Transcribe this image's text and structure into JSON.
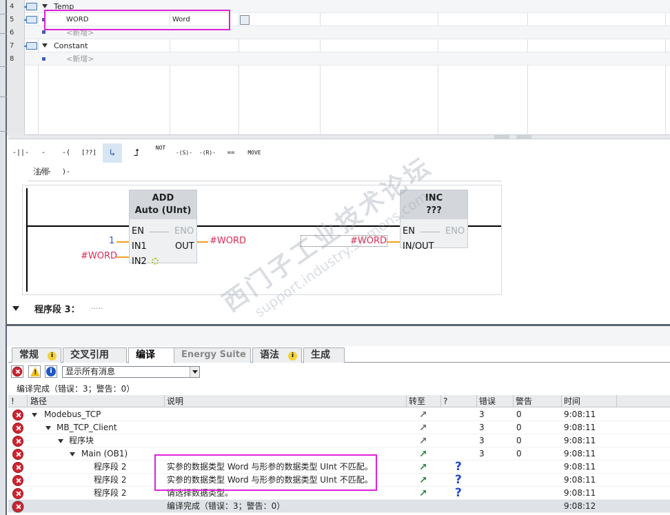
{
  "decl": {
    "rows": [
      {
        "num": "4",
        "name": "Temp",
        "type": ""
      },
      {
        "num": "5",
        "name": "WORD",
        "type": "Word"
      },
      {
        "num": "6",
        "name": "<新增>",
        "type": ""
      },
      {
        "num": "7",
        "name": "Constant",
        "type": ""
      },
      {
        "num": "8",
        "name": "<新增>",
        "type": ""
      }
    ]
  },
  "toolbar": {
    "items": [
      "-||-",
      "-|/|-",
      "-( )-",
      "[??]",
      "↳",
      "⮥",
      "NOT",
      "-(S)-",
      "-(R)-",
      "==",
      "MOVE"
    ]
  },
  "network": {
    "comment": "注释",
    "add_block": {
      "title": "ADD",
      "subtitle": "Auto (UInt)",
      "en": "EN",
      "eno": "ENO",
      "in1": "IN1",
      "in2": "IN2",
      "out": "OUT",
      "in1_val": "1",
      "in2_val": "#WORD",
      "out_val": "#WORD"
    },
    "inc_block": {
      "title": "INC",
      "subtitle": "???",
      "en": "EN",
      "eno": "ENO",
      "inout": "IN/OUT",
      "inout_val": "#WORD"
    },
    "next_segment": "程序段 3：",
    "next_segment_dots": "....."
  },
  "watermark": {
    "line1": "西门子工业",
    "line2": "技术论坛",
    "line3": "support.industry.siemens.com"
  },
  "tabs": [
    {
      "label": "常规",
      "info": true
    },
    {
      "label": "交叉引用",
      "info": false
    },
    {
      "label": "编译",
      "info": false,
      "active": true
    },
    {
      "label": "Energy Suite",
      "info": false
    },
    {
      "label": "语法",
      "info": true
    },
    {
      "label": "生成",
      "info": false
    }
  ],
  "filter": {
    "selected": "显示所有消息"
  },
  "status": "编译完成（错误：3；警告：0）",
  "table": {
    "headers": {
      "bang": "!",
      "path": "路径",
      "desc": "说明",
      "goto": "转至",
      "q": "?",
      "err": "错误",
      "warn": "警告",
      "time": "时间"
    },
    "rows": [
      {
        "path": "Modebus_TCP",
        "desc": "",
        "err": "3",
        "warn": "0",
        "time": "9:08:11"
      },
      {
        "path": "MB_TCP_Client",
        "desc": "",
        "err": "3",
        "warn": "0",
        "time": "9:08:11"
      },
      {
        "path": "程序块",
        "desc": "",
        "err": "3",
        "warn": "0",
        "time": "9:08:11"
      },
      {
        "path": "Main (OB1)",
        "desc": "",
        "err": "3",
        "warn": "0",
        "time": "9:08:11"
      },
      {
        "path": "程序段 2",
        "desc": "实参的数据类型 Word 与形参的数据类型 UInt 不匹配。",
        "err": "",
        "warn": "",
        "time": "9:08:11"
      },
      {
        "path": "程序段 2",
        "desc": "实参的数据类型 Word 与形参的数据类型 UInt 不匹配。",
        "err": "",
        "warn": "",
        "time": "9:08:11"
      },
      {
        "path": "程序段 2",
        "desc": "请选择数据类型。",
        "err": "",
        "warn": "",
        "time": "9:08:11"
      },
      {
        "path": "",
        "desc": "编译完成（错误：3；警告：0）",
        "err": "",
        "warn": "",
        "time": "9:08:12"
      }
    ]
  },
  "colors": {
    "error": "#d1242f",
    "highlight": "#e020d8",
    "variable": "#d72e57",
    "constant": "#2a56c6",
    "goto_arrow_gray": "#6b6f74",
    "goto_arrow_green": "#2a8a3a"
  }
}
